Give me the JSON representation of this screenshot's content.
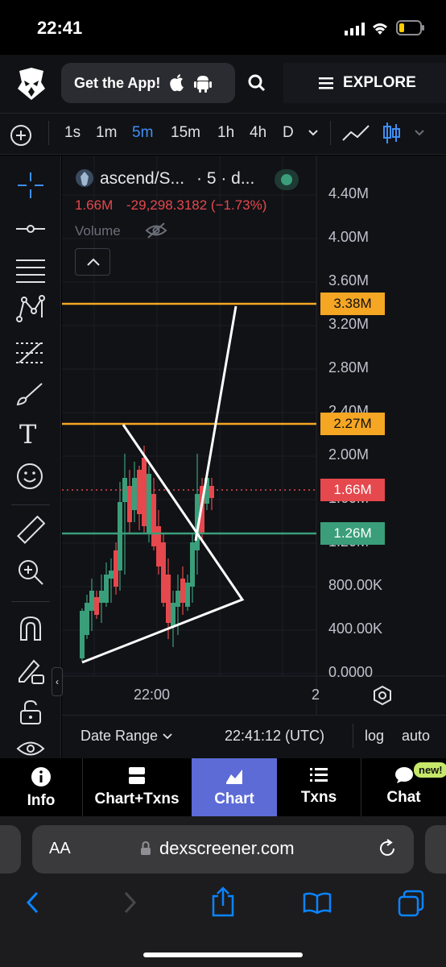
{
  "status_bar": {
    "time": "22:41"
  },
  "header": {
    "get_app_label": "Get the App!",
    "explore_label": "EXPLORE"
  },
  "timeframes": [
    {
      "label": "1s",
      "active": false
    },
    {
      "label": "1m",
      "active": false
    },
    {
      "label": "5m",
      "active": true
    },
    {
      "label": "15m",
      "active": false
    },
    {
      "label": "1h",
      "active": false
    },
    {
      "label": "4h",
      "active": false
    },
    {
      "label": "D",
      "active": false
    }
  ],
  "legend": {
    "symbol": "ascend/S...",
    "interval": "· 5 · d...",
    "last_price": "1.66M",
    "change": "-29,298.3182 (−1.73%)",
    "volume_label": "Volume"
  },
  "price_axis": {
    "ticks": [
      "4.40M",
      "4.00M",
      "3.60M",
      "3.20M",
      "2.80M",
      "2.40M",
      "2.00M",
      "1.60M",
      "1.20M",
      "800.00K",
      "400.00K",
      "0.0000"
    ],
    "labels": [
      {
        "text": "3.38M",
        "color": "#f5a623"
      },
      {
        "text": "2.27M",
        "color": "#f5a623"
      },
      {
        "text": "1.66M",
        "color": "#e5484d"
      },
      {
        "text": "1.26M",
        "color": "#3a9e7a"
      }
    ]
  },
  "time_axis": {
    "labels": [
      "22:00",
      "2"
    ]
  },
  "chart_footer": {
    "date_range_label": "Date Range",
    "clock": "22:41:12 (UTC)",
    "log_label": "log",
    "auto_label": "auto"
  },
  "bottom_tabs": [
    {
      "label": "Info",
      "icon": "info-icon",
      "active": false
    },
    {
      "label": "Chart+Txns",
      "icon": "split-layout-icon",
      "active": false
    },
    {
      "label": "Chart",
      "icon": "chart-icon",
      "active": true
    },
    {
      "label": "Txns",
      "icon": "list-icon",
      "active": false
    },
    {
      "label": "Chat",
      "icon": "chat-bubble-icon",
      "active": false,
      "badge": "new!"
    }
  ],
  "safari": {
    "text_size_label": "AA",
    "url": "dexscreener.com"
  },
  "colors": {
    "accent": "#3f8ff5",
    "up": "#3a9e7a",
    "down": "#e5484d",
    "line": "#f5a623",
    "active_tab": "#5c6bd6"
  }
}
